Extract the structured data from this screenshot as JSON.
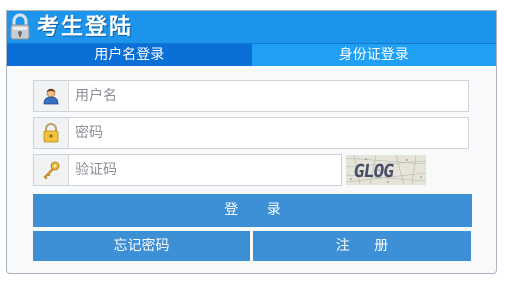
{
  "header": {
    "title": "考生登陆",
    "lock_icon": "padlock-icon"
  },
  "tabs": [
    {
      "label": "用户名登录",
      "active": true
    },
    {
      "label": "身份证登录",
      "active": false
    }
  ],
  "form": {
    "username": {
      "placeholder": "用户名",
      "value": "",
      "icon": "user-icon"
    },
    "password": {
      "placeholder": "密码",
      "value": "",
      "icon": "lock-icon"
    },
    "captcha": {
      "placeholder": "验证码",
      "value": "",
      "icon": "key-icon",
      "image_text": "GLOG"
    }
  },
  "buttons": {
    "login": "登 录",
    "forgot": "忘记密码",
    "register": "注 册"
  },
  "colors": {
    "title_bar": "#1e95ec",
    "tab_active": "#0a6fd6",
    "tab_inactive": "#1fa0f5",
    "button": "#3d8fd6"
  }
}
